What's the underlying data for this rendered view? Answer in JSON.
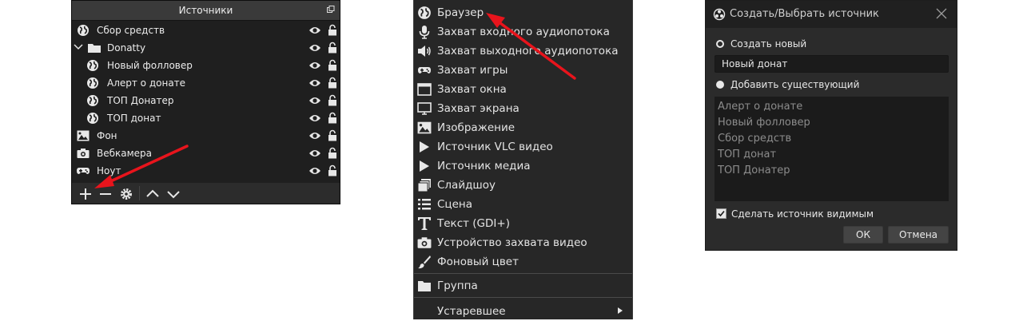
{
  "sources_panel": {
    "title": "Источники",
    "items": [
      {
        "label": "Сбор средств"
      },
      {
        "label": "Donatty"
      },
      {
        "label": "Новый фолловер"
      },
      {
        "label": "Алерт о донате"
      },
      {
        "label": "ТОП Донатер"
      },
      {
        "label": "ТОП донат"
      },
      {
        "label": "Фон"
      },
      {
        "label": "Вебкамера"
      },
      {
        "label": "Ноут"
      }
    ]
  },
  "context_menu": {
    "items": [
      {
        "label": "Браузер"
      },
      {
        "label": "Захват входного аудиопотока"
      },
      {
        "label": "Захват выходного аудиопотока"
      },
      {
        "label": "Захват игры"
      },
      {
        "label": "Захват окна"
      },
      {
        "label": "Захват экрана"
      },
      {
        "label": "Изображение"
      },
      {
        "label": "Источник VLC видео"
      },
      {
        "label": "Источник медиа"
      },
      {
        "label": "Слайдшоу"
      },
      {
        "label": "Сцена"
      },
      {
        "label": "Текст (GDI+)"
      },
      {
        "label": "Устройство захвата видео"
      },
      {
        "label": "Фоновый цвет"
      },
      {
        "label": "Группа"
      },
      {
        "label": "Устаревшее"
      }
    ]
  },
  "dialog": {
    "title": "Создать/Выбрать источник",
    "create_new_label": "Создать новый",
    "name_value": "Новый донат",
    "add_existing_label": "Добавить существующий",
    "existing_items": [
      "Алерт о донате",
      "Новый фолловер",
      "Сбор средств",
      "ТОП донат",
      "ТОП Донатер"
    ],
    "make_visible_label": "Сделать источник видимым",
    "make_visible_checked": true,
    "ok_label": "ОК",
    "cancel_label": "Отмена"
  },
  "colors": {
    "annotation_arrow": "#e8141c",
    "panel_bg": "#1f1f1f",
    "menu_bg": "#272727",
    "dialog_bg": "#2b2b2b"
  }
}
